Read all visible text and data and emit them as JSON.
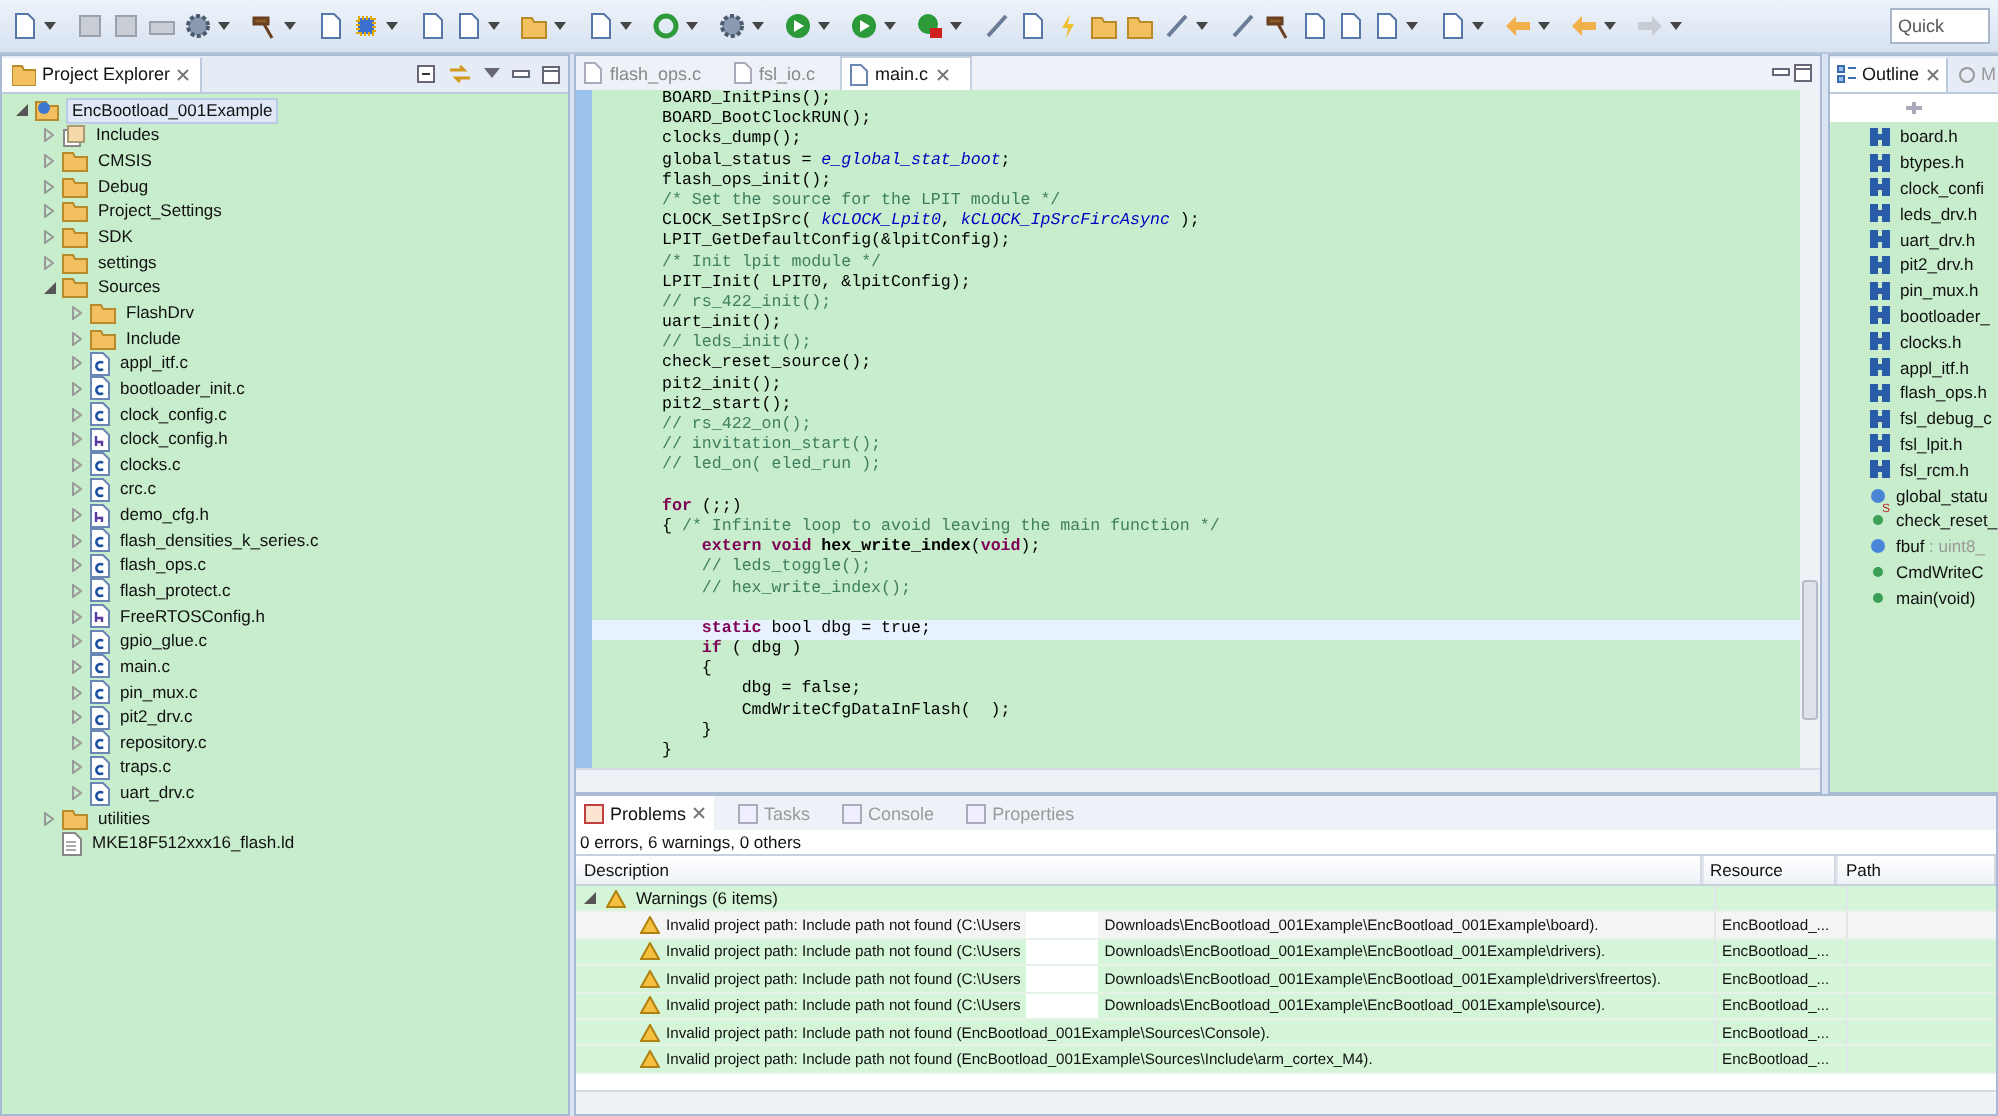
{
  "toolbar": {
    "quick_access": {
      "placeholder": "Quick"
    }
  },
  "project_explorer": {
    "title": "Project Explorer",
    "tree": [
      {
        "label": "EncBootload_001Example",
        "kind": "project",
        "expanded": true,
        "selected": true,
        "children": [
          {
            "label": "Includes",
            "kind": "includes",
            "expanded": false,
            "selected": false
          },
          {
            "label": "CMSIS",
            "kind": "folder",
            "expanded": false,
            "selected": false
          },
          {
            "label": "Debug",
            "kind": "folder",
            "expanded": false,
            "selected": false
          },
          {
            "label": "Project_Settings",
            "kind": "folder",
            "expanded": false,
            "selected": false
          },
          {
            "label": "SDK",
            "kind": "folder",
            "expanded": false,
            "selected": false
          },
          {
            "label": "settings",
            "kind": "folder",
            "expanded": false,
            "selected": false
          },
          {
            "label": "Sources",
            "kind": "folder",
            "expanded": true,
            "selected": false,
            "children": [
              {
                "label": "FlashDrv",
                "kind": "folder",
                "expanded": false,
                "selected": false
              },
              {
                "label": "Include",
                "kind": "folder",
                "expanded": false,
                "selected": false
              },
              {
                "label": "appl_itf.c",
                "kind": "c",
                "expanded": false,
                "selected": false
              },
              {
                "label": "bootloader_init.c",
                "kind": "c",
                "expanded": false,
                "selected": false
              },
              {
                "label": "clock_config.c",
                "kind": "c",
                "expanded": false,
                "selected": false
              },
              {
                "label": "clock_config.h",
                "kind": "h",
                "expanded": false,
                "selected": false
              },
              {
                "label": "clocks.c",
                "kind": "c",
                "expanded": false,
                "selected": false
              },
              {
                "label": "crc.c",
                "kind": "c",
                "expanded": false,
                "selected": false
              },
              {
                "label": "demo_cfg.h",
                "kind": "h",
                "expanded": false,
                "selected": false
              },
              {
                "label": "flash_densities_k_series.c",
                "kind": "c",
                "expanded": false,
                "selected": false
              },
              {
                "label": "flash_ops.c",
                "kind": "c",
                "expanded": false,
                "selected": false
              },
              {
                "label": "flash_protect.c",
                "kind": "c",
                "expanded": false,
                "selected": false
              },
              {
                "label": "FreeRTOSConfig.h",
                "kind": "h",
                "expanded": false,
                "selected": false
              },
              {
                "label": "gpio_glue.c",
                "kind": "c",
                "expanded": false,
                "selected": false
              },
              {
                "label": "main.c",
                "kind": "c",
                "expanded": false,
                "selected": false
              },
              {
                "label": "pin_mux.c",
                "kind": "c",
                "expanded": false,
                "selected": false
              },
              {
                "label": "pit2_drv.c",
                "kind": "c",
                "expanded": false,
                "selected": false
              },
              {
                "label": "repository.c",
                "kind": "c",
                "expanded": false,
                "selected": false
              },
              {
                "label": "traps.c",
                "kind": "c",
                "expanded": false,
                "selected": false
              },
              {
                "label": "uart_drv.c",
                "kind": "c",
                "expanded": false,
                "selected": false
              }
            ]
          },
          {
            "label": "utilities",
            "kind": "folder",
            "expanded": false,
            "selected": false
          },
          {
            "label": "MKE18F512xxx16_flash.ld",
            "kind": "ld",
            "selected": false
          }
        ]
      }
    ]
  },
  "editor": {
    "tabs": [
      {
        "label": "flash_ops.c",
        "selected": false
      },
      {
        "label": "fsl_io.c",
        "selected": false
      },
      {
        "label": "main.c",
        "selected": true
      }
    ],
    "lines": [
      {
        "current": false,
        "segments": [
          {
            "kind": "plain",
            "text": "BOARD_InitPins();"
          }
        ]
      },
      {
        "current": false,
        "segments": [
          {
            "kind": "plain",
            "text": "BOARD_BootClockRUN();"
          }
        ]
      },
      {
        "current": false,
        "segments": [
          {
            "kind": "plain",
            "text": "clocks_dump();"
          }
        ]
      },
      {
        "current": false,
        "segments": [
          {
            "kind": "plain",
            "text": "global_status = "
          },
          {
            "kind": "constant",
            "text": "e_global_stat_boot"
          },
          {
            "kind": "plain",
            "text": ";"
          }
        ]
      },
      {
        "current": false,
        "segments": [
          {
            "kind": "plain",
            "text": "flash_ops_init();"
          }
        ]
      },
      {
        "current": false,
        "segments": [
          {
            "kind": "comment",
            "text": "/* Set the source for the LPIT module */"
          }
        ]
      },
      {
        "current": false,
        "segments": [
          {
            "kind": "plain",
            "text": "CLOCK_SetIpSrc( "
          },
          {
            "kind": "constant",
            "text": "kCLOCK_Lpit0"
          },
          {
            "kind": "plain",
            "text": ", "
          },
          {
            "kind": "constant",
            "text": "kCLOCK_IpSrcFircAsync"
          },
          {
            "kind": "plain",
            "text": " );"
          }
        ]
      },
      {
        "current": false,
        "segments": [
          {
            "kind": "plain",
            "text": "LPIT_GetDefaultConfig(&lpitConfig);"
          }
        ]
      },
      {
        "current": false,
        "segments": [
          {
            "kind": "comment",
            "text": "/* Init lpit module */"
          }
        ]
      },
      {
        "current": false,
        "segments": [
          {
            "kind": "plain",
            "text": "LPIT_Init( LPIT0, &lpitConfig);"
          }
        ]
      },
      {
        "current": false,
        "segments": [
          {
            "kind": "comment",
            "text": "// rs_422_init();"
          }
        ]
      },
      {
        "current": false,
        "segments": [
          {
            "kind": "plain",
            "text": "uart_init();"
          }
        ]
      },
      {
        "current": false,
        "segments": [
          {
            "kind": "comment",
            "text": "// leds_init();"
          }
        ]
      },
      {
        "current": false,
        "segments": [
          {
            "kind": "plain",
            "text": "check_reset_source();"
          }
        ]
      },
      {
        "current": false,
        "segments": [
          {
            "kind": "plain",
            "text": "pit2_init();"
          }
        ]
      },
      {
        "current": false,
        "segments": [
          {
            "kind": "plain",
            "text": "pit2_start();"
          }
        ]
      },
      {
        "current": false,
        "segments": [
          {
            "kind": "comment",
            "text": "// rs_422_on();"
          }
        ]
      },
      {
        "current": false,
        "segments": [
          {
            "kind": "comment",
            "text": "// invitation_start();"
          }
        ]
      },
      {
        "current": false,
        "segments": [
          {
            "kind": "comment",
            "text": "// led_on( eled_run );"
          }
        ]
      },
      {
        "current": false
      },
      {
        "current": false,
        "segments": [
          {
            "kind": "keyword",
            "text": "for"
          },
          {
            "kind": "plain",
            "text": " (;;)"
          }
        ]
      },
      {
        "current": false,
        "segments": [
          {
            "kind": "plain",
            "text": "{ "
          },
          {
            "kind": "comment",
            "text": "/* Infinite loop to avoid leaving the main function */"
          }
        ]
      },
      {
        "current": false,
        "segments": [
          {
            "kind": "keyword",
            "text": "    extern void "
          },
          {
            "kind": "bold",
            "text": "hex_write_index"
          },
          {
            "kind": "plain",
            "text": "("
          },
          {
            "kind": "keyword",
            "text": "void"
          },
          {
            "kind": "plain",
            "text": ");"
          }
        ]
      },
      {
        "current": false,
        "segments": [
          {
            "kind": "comment",
            "text": "    // leds_toggle();"
          }
        ]
      },
      {
        "current": false,
        "segments": [
          {
            "kind": "comment",
            "text": "    // hex_write_index();"
          }
        ]
      },
      {
        "current": false
      },
      {
        "current": true,
        "segments": [
          {
            "kind": "keyword",
            "text": "    static"
          },
          {
            "kind": "plain",
            "text": " bool dbg = true;"
          }
        ]
      },
      {
        "current": false,
        "segments": [
          {
            "kind": "keyword",
            "text": "    if"
          },
          {
            "kind": "plain",
            "text": " ( dbg )"
          }
        ]
      },
      {
        "current": false,
        "segments": [
          {
            "kind": "plain",
            "text": "    {"
          }
        ]
      },
      {
        "current": false,
        "segments": [
          {
            "kind": "plain",
            "text": "        dbg = false;"
          }
        ]
      },
      {
        "current": false,
        "segments": [
          {
            "kind": "plain",
            "text": "        CmdWriteCfgDataInFlash(  );"
          }
        ]
      },
      {
        "current": false,
        "segments": [
          {
            "kind": "plain",
            "text": "    }"
          }
        ]
      },
      {
        "current": false,
        "segments": [
          {
            "kind": "plain",
            "text": "}"
          }
        ]
      }
    ]
  },
  "outline": {
    "tabs": [
      {
        "label": "Outline",
        "selected": true
      },
      {
        "label": "M",
        "selected": false
      }
    ],
    "items": [
      {
        "kind": "include",
        "label": "board.h"
      },
      {
        "kind": "include",
        "label": "btypes.h"
      },
      {
        "kind": "include",
        "label": "clock_confi"
      },
      {
        "kind": "include",
        "label": "leds_drv.h"
      },
      {
        "kind": "include",
        "label": "uart_drv.h"
      },
      {
        "kind": "include",
        "label": "pit2_drv.h"
      },
      {
        "kind": "include",
        "label": "pin_mux.h"
      },
      {
        "kind": "include",
        "label": "bootloader_"
      },
      {
        "kind": "include",
        "label": "clocks.h"
      },
      {
        "kind": "include",
        "label": "appl_itf.h"
      },
      {
        "kind": "include",
        "label": "flash_ops.h"
      },
      {
        "kind": "include",
        "label": "fsl_debug_c"
      },
      {
        "kind": "include",
        "label": "fsl_lpit.h"
      },
      {
        "kind": "include",
        "label": "fsl_rcm.h"
      },
      {
        "kind": "variable",
        "label": "global_statu"
      },
      {
        "kind": "function",
        "label": "check_reset_",
        "badge": "S"
      },
      {
        "kind": "variable",
        "label": "fbuf",
        "detail": " : uint8_"
      },
      {
        "kind": "function",
        "label": "CmdWriteC"
      },
      {
        "kind": "function",
        "label": "main(void)"
      }
    ]
  },
  "problems": {
    "tabs": [
      {
        "label": "Problems",
        "selected": true
      },
      {
        "label": "Tasks",
        "selected": false
      },
      {
        "label": "Console",
        "selected": false
      },
      {
        "label": "Properties",
        "selected": false
      }
    ],
    "summary": "0 errors, 6 warnings, 0 others",
    "columns": [
      "Description",
      "Resource",
      "Path"
    ],
    "groups": [
      {
        "label": "Warnings (6 items)",
        "expanded": true,
        "rows": [
          {
            "description": [
              "Invalid project path: Include path not found (C:\\Users",
              "Downloads\\EncBootload_001Example\\EncBootload_001Example\\board)."
            ],
            "resource": "EncBootload_...",
            "selected": true
          },
          {
            "description": [
              "Invalid project path: Include path not found (C:\\Users",
              "Downloads\\EncBootload_001Example\\EncBootload_001Example\\drivers)."
            ],
            "resource": "EncBootload_...",
            "selected": false
          },
          {
            "description": [
              "Invalid project path: Include path not found (C:\\Users",
              "Downloads\\EncBootload_001Example\\EncBootload_001Example\\drivers\\freertos)."
            ],
            "resource": "EncBootload_...",
            "selected": false
          },
          {
            "description": [
              "Invalid project path: Include path not found (C:\\Users",
              "Downloads\\EncBootload_001Example\\EncBootload_001Example\\source)."
            ],
            "resource": "EncBootload_...",
            "selected": false
          },
          {
            "description": [
              "Invalid project path: Include path not found (EncBootload_001Example\\Sources\\Console)."
            ],
            "resource": "EncBootload_...",
            "selected": false
          },
          {
            "description": [
              "Invalid project path: Include path not found (EncBootload_001Example\\Sources\\Include\\arm_cortex_M4)."
            ],
            "resource": "EncBootload_...",
            "selected": false
          }
        ]
      }
    ]
  }
}
